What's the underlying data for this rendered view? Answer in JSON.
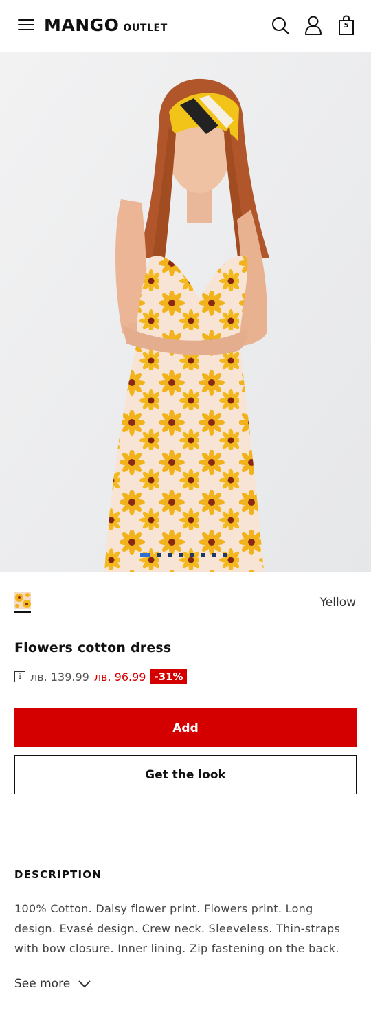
{
  "header": {
    "brand": "MANGO",
    "brand_sub": "OUTLET",
    "bag_count": "5",
    "icons": [
      "menu-icon",
      "search-icon",
      "user-icon",
      "bag-icon"
    ]
  },
  "gallery": {
    "image_count": 9,
    "active_index": 0
  },
  "product": {
    "color": "Yellow",
    "title": "Flowers cotton dress",
    "old_price": "лв. 139.99",
    "new_price": "лв. 96.99",
    "discount": "-31%"
  },
  "actions": {
    "add_label": "Add",
    "look_label": "Get the look"
  },
  "description": {
    "heading": "DESCRIPTION",
    "text": "100% Cotton. Daisy flower print. Flowers print. Long design. Evasé design. Crew neck. Sleeveless. Thin-straps with bow closure. Inner lining. Zip fastening on the back.",
    "see_more": "See more"
  },
  "colors": {
    "accent": "#d40000",
    "text": "#111111",
    "dot_active": "#2d6fd6",
    "dot": "#1b3a66"
  }
}
